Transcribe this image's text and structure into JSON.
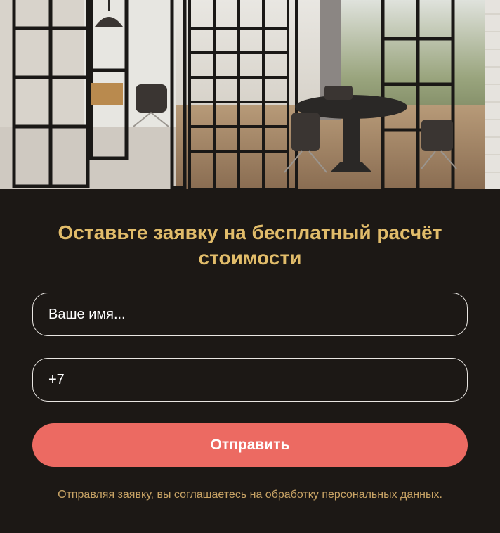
{
  "form": {
    "title": "Оставьте заявку на бесплатный расчёт стоимости",
    "name_placeholder": "Ваше имя...",
    "phone_value": "+7",
    "submit_label": "Отправить",
    "consent_text": "Отправляя заявку, вы соглашаетесь на обработку персональных данных."
  },
  "colors": {
    "background": "#1c1815",
    "title": "#e1bc6a",
    "button": "#ec6a62",
    "consent": "#c8a365",
    "field_border": "#e9e6e2"
  },
  "hero_image": {
    "subject": "office interior with black-framed glass partitions and conference table"
  }
}
